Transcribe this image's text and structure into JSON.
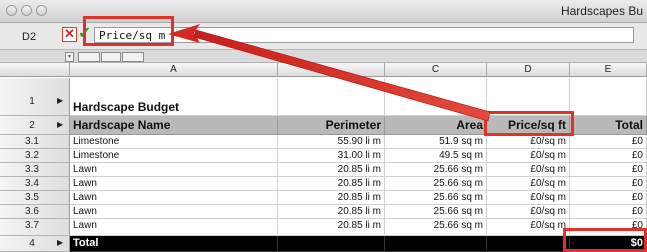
{
  "window": {
    "title": "Hardscapes Bu"
  },
  "formula_bar": {
    "cell_ref": "D2",
    "cancel_symbol": "✕",
    "accept_symbol": "✓",
    "value": "Price/sq m"
  },
  "columns": [
    "A",
    "",
    "C",
    "D",
    "E"
  ],
  "rows": [
    {
      "num": "1",
      "a": "Hardscape Budget"
    },
    {
      "num": "2",
      "a": "Hardscape Name",
      "b": "Perimeter",
      "c": "Area",
      "d": "Price/sq ft",
      "e": "Total"
    },
    {
      "num": "3.1",
      "a": "Limestone",
      "b": "55.90 li m",
      "c": "51.9 sq m",
      "d": "£0/sq m",
      "e": "£0"
    },
    {
      "num": "3.2",
      "a": "Limestone",
      "b": "31.00 li m",
      "c": "49.5 sq m",
      "d": "£0/sq m",
      "e": "£0"
    },
    {
      "num": "3.3",
      "a": "Lawn",
      "b": "20.85 li m",
      "c": "25.66 sq m",
      "d": "£0/sq m",
      "e": "£0"
    },
    {
      "num": "3.4",
      "a": "Lawn",
      "b": "20.85 li m",
      "c": "25.66 sq m",
      "d": "£0/sq m",
      "e": "£0"
    },
    {
      "num": "3.5",
      "a": "Lawn",
      "b": "20.85 li m",
      "c": "25.66 sq m",
      "d": "£0/sq m",
      "e": "£0"
    },
    {
      "num": "3.6",
      "a": "Lawn",
      "b": "20.85 li m",
      "c": "25.66 sq m",
      "d": "£0/sq m",
      "e": "£0"
    },
    {
      "num": "3.7",
      "a": "Lawn",
      "b": "20.85 li m",
      "c": "25.66 sq m",
      "d": "£0/sq m",
      "e": "£0"
    },
    {
      "num": "4",
      "a": "Total",
      "e": "$0"
    }
  ],
  "colors": {
    "annotation": "#e0322a",
    "header_row": "#b9b9b9",
    "total_row": "#000000"
  }
}
